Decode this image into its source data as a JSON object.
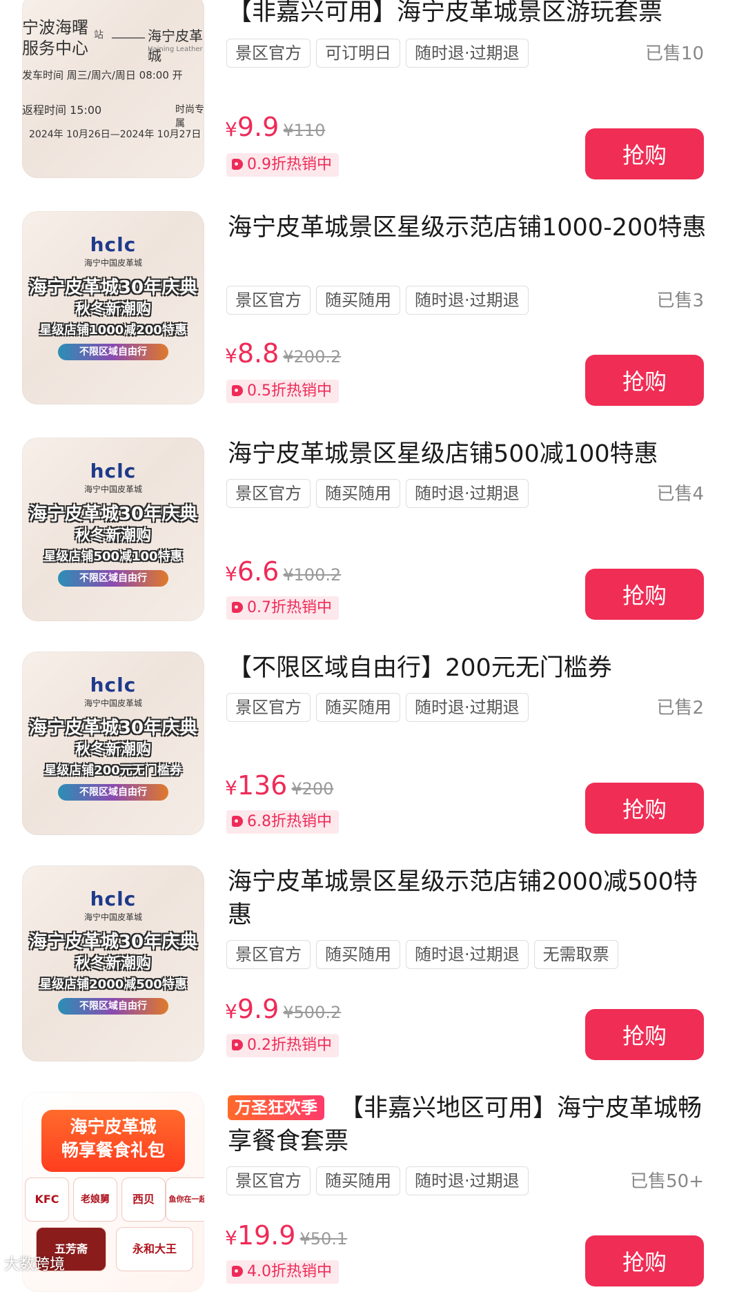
{
  "buy_label": "抢购",
  "watermark": "大数跨境",
  "items": [
    {
      "title": "【非嘉兴可用】海宁皮革城景区游玩套票",
      "tags": [
        "景区官方",
        "可订明日",
        "随时退·过期退"
      ],
      "sold": "已售10",
      "price_currency": "¥",
      "price": "9.9",
      "original_price": "¥110",
      "discount": "0.9折热销中",
      "thumb": {
        "line1": "宁波海曙",
        "line2": "服务中心",
        "station": "站",
        "dest": "海宁皮革城",
        "dest_en": "Haining Leather City",
        "line3": "发车时间 周三/周六/周日 08:00 开",
        "line4": "返程时间 15:00",
        "line5": "时尚专属",
        "line6": "2024年 10月26日—2024年 10月27日"
      }
    },
    {
      "title": "海宁皮革城景区星级示范店铺1000-200特惠",
      "tags": [
        "景区官方",
        "随买随用",
        "随时退·过期退"
      ],
      "sold": "已售3",
      "price_currency": "¥",
      "price": "8.8",
      "original_price": "¥200.2",
      "discount": "0.5折热销中",
      "thumb": {
        "logo": "hclc",
        "logo_sub": "海宁中国皮革城",
        "b1": "海宁皮革城30年庆典",
        "b2": "秋冬新潮购",
        "b3": "星级店铺1000减200特惠",
        "pill": "不限区域自由行"
      }
    },
    {
      "title": "海宁皮革城景区星级店铺500减100特惠",
      "tags": [
        "景区官方",
        "随买随用",
        "随时退·过期退"
      ],
      "sold": "已售4",
      "price_currency": "¥",
      "price": "6.6",
      "original_price": "¥100.2",
      "discount": "0.7折热销中",
      "thumb": {
        "logo": "hclc",
        "logo_sub": "海宁中国皮革城",
        "b1": "海宁皮革城30年庆典",
        "b2": "秋冬新潮购",
        "b3": "星级店铺500减100特惠",
        "pill": "不限区域自由行"
      }
    },
    {
      "title": "【不限区域自由行】200元无门槛券",
      "tags": [
        "景区官方",
        "随买随用",
        "随时退·过期退"
      ],
      "sold": "已售2",
      "price_currency": "¥",
      "price": "136",
      "original_price": "¥200",
      "discount": "6.8折热销中",
      "thumb": {
        "logo": "hclc",
        "logo_sub": "海宁中国皮革城",
        "b1": "海宁皮革城30年庆典",
        "b2": "秋冬新潮购",
        "b3": "星级店铺200元无门槛券",
        "pill": "不限区域自由行"
      }
    },
    {
      "title": "海宁皮革城景区星级示范店铺2000减500特惠",
      "tags": [
        "景区官方",
        "随买随用",
        "随时退·过期退",
        "无需取票"
      ],
      "sold": "",
      "price_currency": "¥",
      "price": "9.9",
      "original_price": "¥500.2",
      "discount": "0.2折热销中",
      "thumb": {
        "logo": "hclc",
        "logo_sub": "海宁中国皮革城",
        "b1": "海宁皮革城30年庆典",
        "b2": "秋冬新潮购",
        "b3": "星级店铺2000减500特惠",
        "pill": "不限区域自由行"
      }
    },
    {
      "promo": "万圣狂欢季",
      "title": "【非嘉兴地区可用】海宁皮革城畅享餐食套票",
      "tags": [
        "景区官方",
        "随买随用",
        "随时退·过期退"
      ],
      "sold": "已售50+",
      "price_currency": "¥",
      "price": "19.9",
      "original_price": "¥50.1",
      "discount": "4.0折热销中",
      "thumb": {
        "h1": "海宁皮革城",
        "h2": "畅享餐食礼包",
        "brands": [
          "KFC",
          "老娘舅",
          "西贝",
          "鱼你在一起",
          "五芳斋",
          "永和大王"
        ]
      }
    }
  ]
}
